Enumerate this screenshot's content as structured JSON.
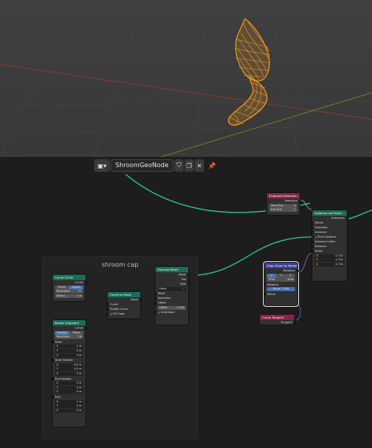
{
  "header": {
    "node_tree_name": "ShroomGeoNode"
  },
  "frame": {
    "label": "shroom cap"
  },
  "nodes": {
    "endpoint_selection": {
      "title": "Endpoint Selection",
      "out_selection": "Selection",
      "start_size_label": "Start Size",
      "start_size_value": "0",
      "end_size_label": "End Size",
      "end_size_value": "1"
    },
    "instance_on_points": {
      "title": "Instance on Points",
      "out_instances": "Instances",
      "in_points": "Points",
      "in_selection": "Selection",
      "in_instance": "Instance",
      "pick_instance": "Pick Instance",
      "instance_index": "Instance Index",
      "rotation": "Rotation",
      "scale": "Scale",
      "scale_x": "X",
      "scale_x_val": "0.720",
      "scale_y": "Y",
      "scale_y_val": "0.720",
      "scale_z": "Z",
      "scale_z_val": "0.720"
    },
    "align_euler": {
      "title": "Align Euler to Vector",
      "out_rotation": "Rotation",
      "axis_x": "X",
      "axis_y": "Y",
      "axis_z": "Z",
      "pivot_label": "Pivot",
      "pivot_value": "Auto",
      "in_rotation": "Rotation",
      "factor_label": "Factor",
      "factor_value": "1.000",
      "in_vector": "Vector"
    },
    "curve_tangent": {
      "title": "Curve Tangent",
      "out_tangent": "Tangent"
    },
    "curve_circle": {
      "title": "Curve Circle",
      "out_curve": "Curve",
      "mode_points": "Points",
      "mode_radius": "Radius",
      "resolution_label": "Resolution",
      "resolution_value": "32",
      "radius_label": "Radius",
      "radius_value": "1 m"
    },
    "bezier_segment": {
      "title": "Bezier Segment",
      "out_curve": "Curve",
      "mode_position": "Position",
      "mode_offset": "Offset",
      "resolution_label": "Resolution",
      "resolution_value": "16",
      "start_label": "Start",
      "start_x": "X",
      "start_x_val": "-1 m",
      "start_y": "Y",
      "start_y_val": "0 m",
      "start_z": "Z",
      "start_z_val": "0 m",
      "start_handle_label": "Start Handle",
      "sh_x": "X",
      "sh_x_val": "-0.5 m",
      "sh_y": "Y",
      "sh_y_val": "0.5 m",
      "sh_z": "Z",
      "sh_z_val": "0 m",
      "end_handle_label": "End Handle",
      "eh_x": "X",
      "eh_x_val": "0 m",
      "eh_y": "Y",
      "eh_y_val": "0 m",
      "eh_z": "Z",
      "eh_z_val": "0 m",
      "end_label": "End",
      "end_x": "X",
      "end_x_val": "1 m",
      "end_y": "Y",
      "end_y_val": "0 m",
      "end_z": "Z",
      "end_z_val": "0 m"
    },
    "curve_to_mesh": {
      "title": "Curve to Mesh",
      "out_mesh": "Mesh",
      "in_curve": "Curve",
      "in_profile": "Profile Curve",
      "fill_caps": "Fill Caps"
    },
    "extrude_mesh": {
      "title": "Extrude Mesh",
      "out_mesh": "Mesh",
      "out_top": "Top",
      "out_side": "Side",
      "mode_value": "Faces",
      "in_mesh": "Mesh",
      "in_selection": "Selection",
      "in_offset": "Offset",
      "offset_scale_label": "Offset",
      "offset_scale_value": "-0.100",
      "individual": "Individual"
    }
  },
  "colors": {
    "geometry_header": "#1b6b58",
    "input_header": "#8a2245",
    "vector_header": "#3a3f9e",
    "wire": "#2ec4a0",
    "mesh_orange": "#f49a1a"
  }
}
